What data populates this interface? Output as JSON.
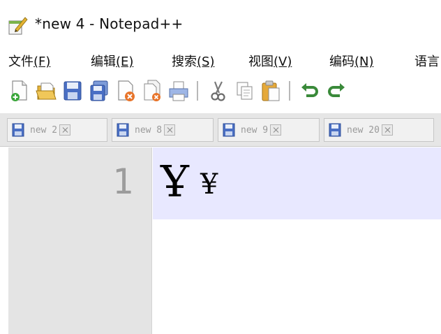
{
  "window": {
    "title": "*new 4 - Notepad++",
    "icon": "notepad-pencil-icon"
  },
  "menu": {
    "items": [
      {
        "label": "文件",
        "accel": "(F)"
      },
      {
        "label": "编辑",
        "accel": "(E)"
      },
      {
        "label": "搜索",
        "accel": "(S)"
      },
      {
        "label": "视图",
        "accel": "(V)"
      },
      {
        "label": "编码",
        "accel": "(N)"
      },
      {
        "label": "语言",
        "accel": ""
      }
    ]
  },
  "toolbar": {
    "icons": [
      "new-file-icon",
      "open-file-icon",
      "save-icon",
      "save-all-icon",
      "close-icon",
      "close-all-icon",
      "print-icon",
      "cut-icon",
      "copy-icon",
      "paste-icon",
      "undo-icon",
      "redo-icon"
    ]
  },
  "tabs": [
    {
      "label": "new 2",
      "icon": "unsaved-disk-icon"
    },
    {
      "label": "new 8",
      "icon": "unsaved-disk-icon"
    },
    {
      "label": "new 9",
      "icon": "unsaved-disk-icon"
    },
    {
      "label": "new 20",
      "icon": "unsaved-disk-icon"
    }
  ],
  "editor": {
    "line_number": "1",
    "line_text_big": "Ұ",
    "line_text_small": "¥"
  },
  "colors": {
    "current_line": "#e8e8ff",
    "gutter": "#e4e4e4",
    "tab_bar": "#e6e6e6",
    "disk_blue": "#4a6fc4"
  }
}
